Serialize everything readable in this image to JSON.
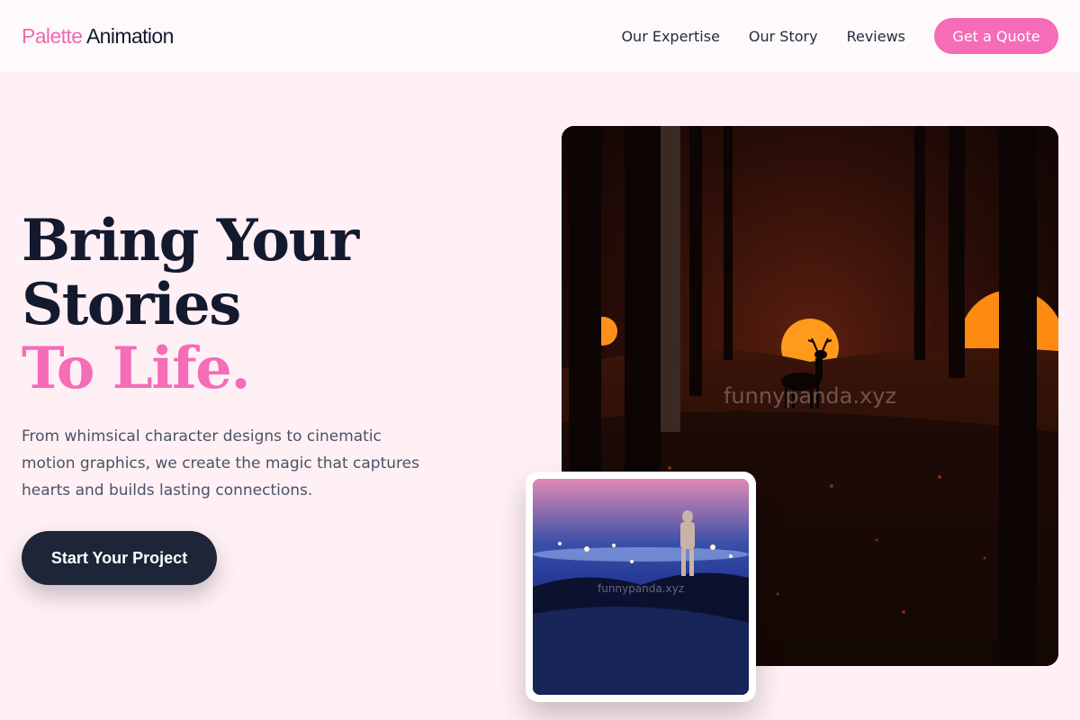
{
  "brand": {
    "accent": "Palette",
    "rest": "Animation"
  },
  "nav": {
    "items": [
      "Our Expertise",
      "Our Story",
      "Reviews"
    ],
    "cta": "Get a Quote"
  },
  "hero": {
    "line1": "Bring Your",
    "line2": "Stories",
    "line3": "To Life.",
    "subtext": "From whimsical character designs to cinematic motion graphics, we create the magic that captures hearts and builds lasting connections.",
    "button": "Start Your Project"
  },
  "images": {
    "main_watermark": "funnypanda.xyz",
    "small_watermark": "funnypanda.xyz"
  },
  "colors": {
    "accent_pink": "#f56cb7",
    "dark_navy": "#1e2538",
    "page_bg": "#fff0f5"
  }
}
